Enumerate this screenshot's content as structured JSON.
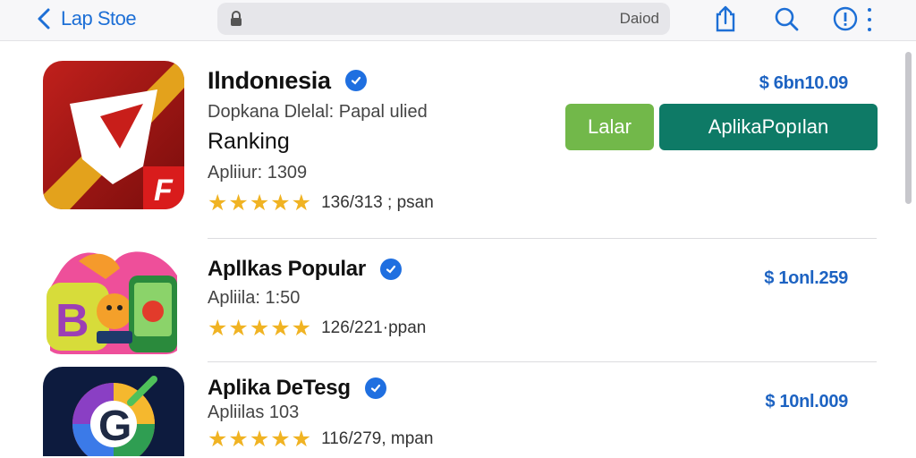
{
  "topbar": {
    "back_label": "Lap Stoe",
    "search_value": "",
    "search_right_text": "Daiod"
  },
  "apps": [
    {
      "title": "Ilndonıesia",
      "subtitle": "Dopkana Dlelal: Papal ulied",
      "ranking_label": "Ranking",
      "app_count": "Apliiur: 1309",
      "stars": "★★★★★",
      "rating_text": "136/313 ; psan",
      "price": "$ 6bn10.09",
      "primary_button": "Lalar",
      "secondary_button": "AplikaPopılan"
    },
    {
      "title": "Apllkas Popular",
      "app_count": "Apliila: 1:50",
      "stars": "★★★★★",
      "rating_text": "126/221·ppan",
      "price": "$ 1onl.259"
    },
    {
      "title": "Aplika DeTesg",
      "app_count": "Apliilas 103",
      "stars": "★★★★★",
      "rating_text": "116/279, mpan",
      "price": "$ 10nl.009"
    }
  ],
  "colors": {
    "accent": "#1d6fd6",
    "price": "#1d63c2",
    "star": "#f0b323",
    "button_green": "#72b84a",
    "button_teal": "#0e7a66"
  }
}
